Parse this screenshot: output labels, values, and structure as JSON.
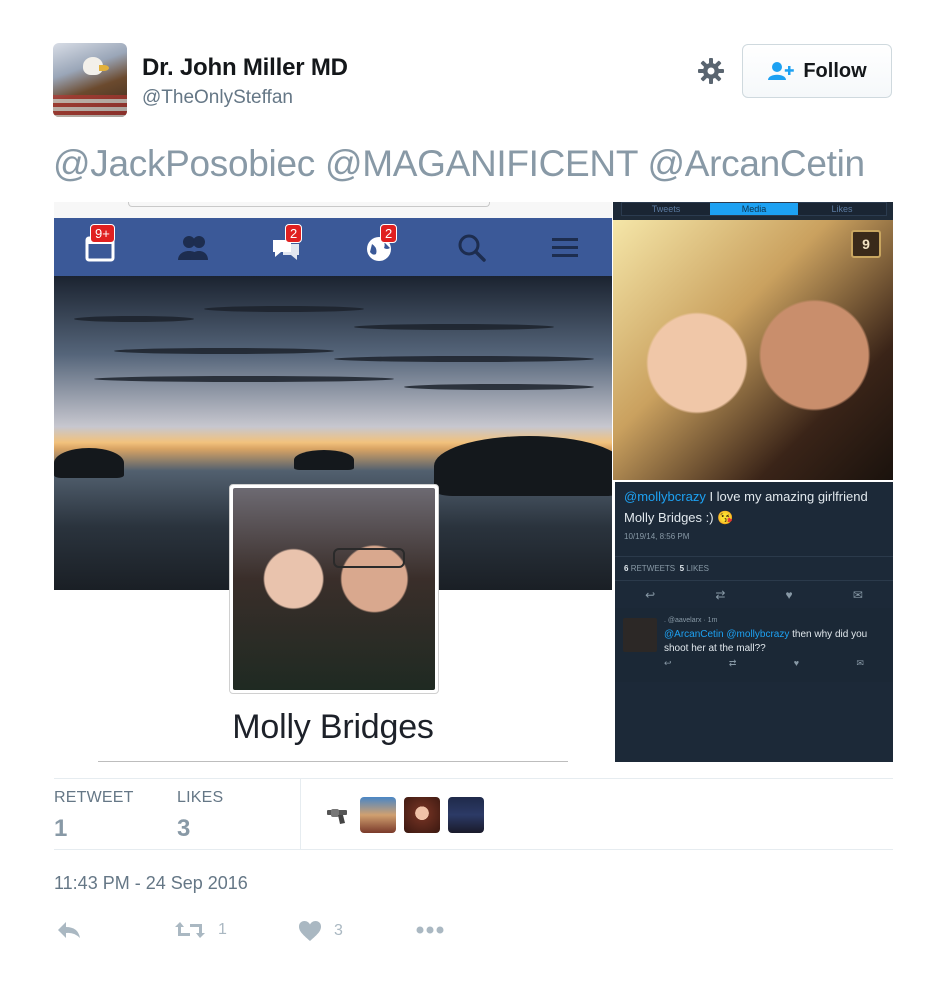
{
  "author": {
    "name": "Dr. John Miller MD",
    "handle": "@TheOnlySteffan",
    "avatar_icon": "eagle-flag-avatar"
  },
  "header": {
    "settings_icon": "gear-icon",
    "follow_label": "Follow",
    "follow_icon": "add-user-icon"
  },
  "tweet": {
    "mentions": [
      "@JackPosobiec",
      "@MAGANIFICENT",
      "@ArcanCetin"
    ]
  },
  "media": {
    "facebook_screenshot": {
      "nav_badges": [
        "9+",
        "2",
        "2"
      ],
      "nav_icons": [
        "calendar-icon",
        "friends-icon",
        "messages-icon",
        "globe-icon",
        "search-icon",
        "menu-icon"
      ],
      "profile_name": "Molly Bridges",
      "nav_color": "#3b5998"
    },
    "instagram_screenshot": {
      "tabs": [
        "Tweets",
        "Media",
        "Likes"
      ],
      "active_tab": "Media",
      "count_badge": "9"
    },
    "dark_tweet": {
      "mention": "@mollybcrazy",
      "text_rest": " I love my amazing girlfriend Molly Bridges :) ",
      "emoji": "😘",
      "date": "10/19/14, 8:56 PM",
      "retweets_count": "6",
      "retweets_label": "RETWEETS",
      "likes_count": "5",
      "likes_label": "LIKES",
      "reply": {
        "header": ". @aavelarx · 1m",
        "mention_1": "@ArcanCetin",
        "mention_2": "@mollybcrazy",
        "text": " then why did you shoot her at the mall??"
      }
    }
  },
  "stats": {
    "retweet_label": "RETWEET",
    "retweet_count": "1",
    "likes_label": "LIKES",
    "likes_count": "3",
    "liker_icons": [
      "revolver-emoji",
      "liker-avatar-1",
      "liker-avatar-2",
      "liker-avatar-3"
    ]
  },
  "timestamp": "11:43 PM - 24 Sep 2016",
  "footer": {
    "retweet_count": "1",
    "like_count": "3"
  },
  "colors": {
    "accent": "#1da1f2",
    "mention_gray": "#8899a6",
    "dark_bg": "#1c2938"
  }
}
